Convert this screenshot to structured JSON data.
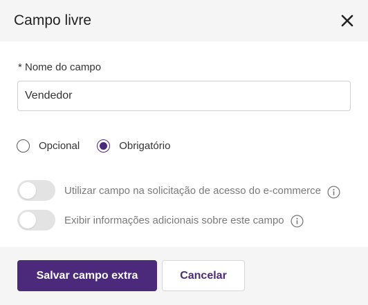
{
  "modal": {
    "title": "Campo livre",
    "close_icon": "close-icon"
  },
  "field": {
    "label": "* Nome do campo",
    "value": "Vendedor",
    "placeholder": ""
  },
  "requirement": {
    "options": [
      {
        "label": "Opcional",
        "checked": false
      },
      {
        "label": "Obrigatório",
        "checked": true
      }
    ]
  },
  "toggles": [
    {
      "label": "Utilizar campo na solicitação de acesso do e-commerce",
      "on": false,
      "icon": "info-icon"
    },
    {
      "label": "Exibir informações adicionais sobre este campo",
      "on": false,
      "icon": "info-icon"
    }
  ],
  "footer": {
    "save_label": "Salvar campo extra",
    "cancel_label": "Cancelar"
  },
  "colors": {
    "accent": "#4b2a7b",
    "header_bg": "#f5f5f5",
    "toggle_off": "#e3e3e3",
    "muted_text": "#7a7a7a"
  }
}
